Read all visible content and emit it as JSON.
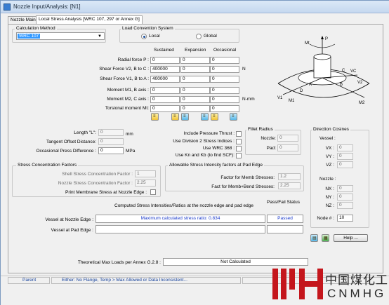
{
  "window": {
    "title": "Nozzle Input/Analysis: [N1]"
  },
  "tabs": [
    {
      "label": "Nozzle Main"
    },
    {
      "label": "Local Stress Analysis [WRC 107, 297 or Annex G]"
    }
  ],
  "calc_method": {
    "group_label": "Calculation Method",
    "selected": "WRC 107"
  },
  "load_convention": {
    "group_label": "Load Convention System",
    "local_label": "Local",
    "global_label": "Global",
    "selected": "Local"
  },
  "loads": {
    "col_headers": [
      "Sustained",
      "Expansion",
      "Occasional"
    ],
    "unit_force": "N",
    "unit_moment": "N-mm",
    "rows": [
      {
        "label": "Radial force P :",
        "values": [
          "0",
          "0",
          "0"
        ]
      },
      {
        "label": "Shear Force V2, B to C :",
        "values": [
          "400000",
          "0",
          "0"
        ]
      },
      {
        "label": "Shear Force V1, B to A :",
        "values": [
          "400000",
          "0",
          "0"
        ]
      },
      {
        "label": "Moment M1, B axis :",
        "values": [
          "0",
          "0",
          "0"
        ]
      },
      {
        "label": "Moment M2, C axis :",
        "values": [
          "0",
          "0",
          "0"
        ]
      },
      {
        "label": "Torsional moment Mt:",
        "values": [
          "0",
          "0",
          "0"
        ]
      }
    ]
  },
  "geometry": {
    "length_label": "Length \"L\":",
    "length_value": "0",
    "length_unit": "mm",
    "tangent_label": "Tangent Offset Distance:",
    "tangent_value": "0",
    "occ_label": "Occasional Press Difference :",
    "occ_value": "0",
    "occ_unit": "MPa"
  },
  "options": {
    "include_thrust": "Include Pressure Thrust :",
    "use_div2": "Use Division 2 Stress Indices :",
    "use_wrc368": "Use WRC 368 :",
    "use_kn_kb": "Use Kn and Kb (to find SCF):"
  },
  "fillet": {
    "group_label": "Fillet Radius",
    "nozzle_label": "Nozzle:",
    "nozzle_value": "0",
    "pad_label": "Pad:",
    "pad_value": "0"
  },
  "direction_cosines": {
    "group_label": "Direction Cosines",
    "vessel_label": "Vessel :",
    "vessel": [
      {
        "label": "VX :",
        "value": "0"
      },
      {
        "label": "VY :",
        "value": "0"
      },
      {
        "label": "VZ :",
        "value": "0"
      }
    ],
    "nozzle_label": "Nozzle :",
    "nozzle": [
      {
        "label": "NX :",
        "value": "0"
      },
      {
        "label": "NY :",
        "value": "0"
      },
      {
        "label": "NZ :",
        "value": "0"
      }
    ],
    "node_label": "Node # :",
    "node_value": "10"
  },
  "scf": {
    "group_label": "Stress Concentration Factors",
    "shell_label": "Shell Stress Concentration Factor :",
    "shell_value": "1",
    "nozzle_label": "Nozzle Stress Concentration Factor :",
    "nozzle_value": "2.25",
    "print_label": "Print Membrane Stress at Nozzle Edge :"
  },
  "allowable": {
    "group_label": "Allowable Stress Intensity factors at Pad Edge",
    "memb_label": "Factor for Memb Stresses:",
    "memb_value": "1.2",
    "bend_label": "Fact for Memb+Bend Stresses:",
    "bend_value": "2.25"
  },
  "results": {
    "header": "Computed Stress Intensities/Ratios at the nozzle edge and pad edge",
    "pass_fail_header": "Pass/Fail Status",
    "nozzle_edge_label": "Vessel at Nozzle Edge :",
    "nozzle_edge_value": "Maximum calculated stress ratio: 0.834",
    "nozzle_edge_status": "Passed",
    "pad_edge_label": "Vessel at Pad Edge :",
    "pad_edge_value": "",
    "pad_edge_status": ""
  },
  "max_loads": {
    "label": "Theoretical Max Loads per Annex G.2.8 :",
    "value": "Not Calculated"
  },
  "help_button": "Help ...",
  "status_bar": {
    "left": "Parent",
    "message": "Either: No Flange, Temp > Max Allowed or Data Inconsistent..."
  },
  "diagram": {
    "labels": [
      "P",
      "Mt",
      "C",
      "VC",
      "A",
      "B",
      "V2",
      "V1",
      "M1",
      "M2",
      "D"
    ]
  },
  "watermark": {
    "chinese": "中国煤化工",
    "latin": "CNMHG"
  },
  "colors": {
    "selection": "#3399ff",
    "logo_red": "#c4161c",
    "status_text": "#17439c",
    "passed_text": "#1737c9"
  }
}
